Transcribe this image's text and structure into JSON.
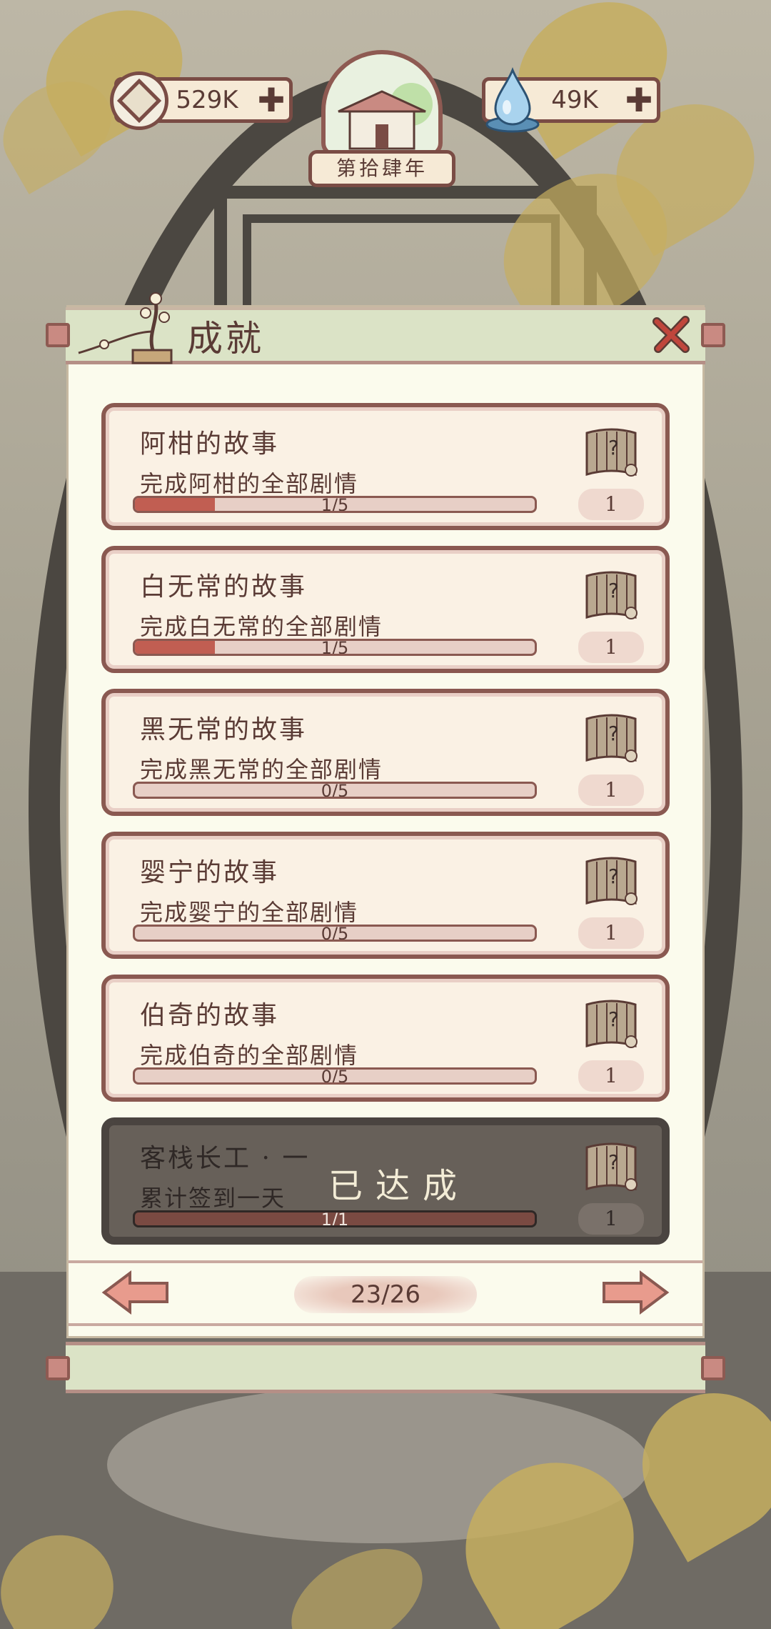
{
  "header": {
    "coins": {
      "value": "529K",
      "icon": "coin-icon"
    },
    "essence": {
      "value": "49K",
      "icon": "water-drop-icon"
    },
    "year_label": "第拾肆年"
  },
  "panel": {
    "title": "成就",
    "close_icon": "close-icon"
  },
  "achievements": [
    {
      "name": "阿柑的故事",
      "desc": "完成阿柑的全部剧情",
      "progress_text": "1/5",
      "progress": 0.2,
      "reward": "1",
      "done": false
    },
    {
      "name": "白无常的故事",
      "desc": "完成白无常的全部剧情",
      "progress_text": "1/5",
      "progress": 0.2,
      "reward": "1",
      "done": false
    },
    {
      "name": "黑无常的故事",
      "desc": "完成黑无常的全部剧情",
      "progress_text": "0/5",
      "progress": 0,
      "reward": "1",
      "done": false
    },
    {
      "name": "婴宁的故事",
      "desc": "完成婴宁的全部剧情",
      "progress_text": "0/5",
      "progress": 0,
      "reward": "1",
      "done": false
    },
    {
      "name": "伯奇的故事",
      "desc": "完成伯奇的全部剧情",
      "progress_text": "0/5",
      "progress": 0,
      "reward": "1",
      "done": false
    },
    {
      "name": "客栈长工 · 一",
      "desc": "累计签到一天",
      "progress_text": "1/1",
      "progress": 1,
      "reward": "1",
      "done": true,
      "done_label": "已达成"
    }
  ],
  "pager": {
    "current": "23/26"
  },
  "colors": {
    "accent": "#8a5951",
    "progress_fill": "#c15e52",
    "panel_bg": "#fbfbed",
    "header_green": "#dbe3c6"
  }
}
